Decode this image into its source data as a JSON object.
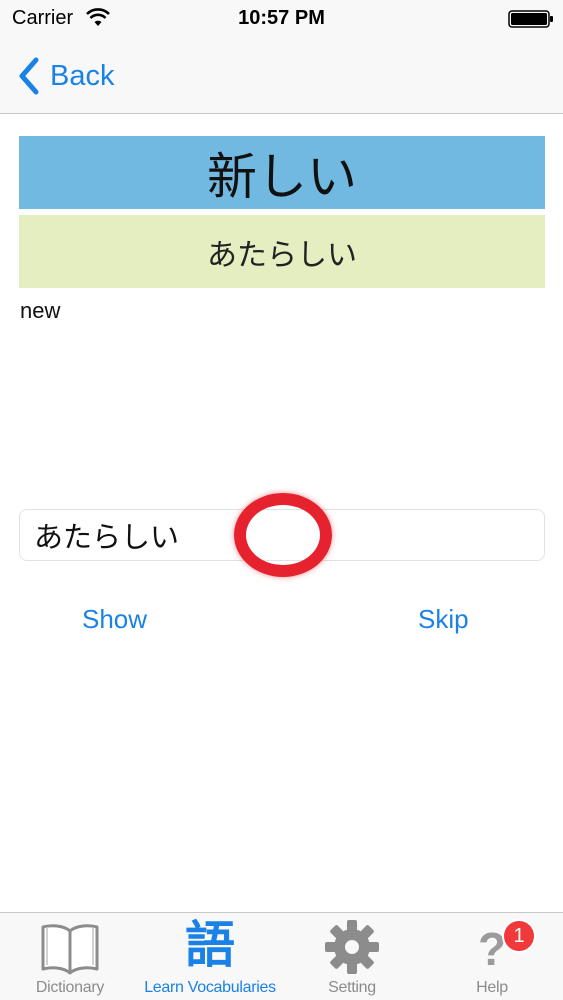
{
  "status_bar": {
    "carrier": "Carrier",
    "time": "10:57 PM",
    "icons": [
      "wifi-icon",
      "battery-icon"
    ]
  },
  "nav": {
    "back_label": "Back",
    "back_icon": "chevron-left-icon"
  },
  "card": {
    "kanji": "新しい",
    "reading": "あたらしい",
    "meaning": "new"
  },
  "answer": {
    "value": "あたらしい"
  },
  "actions": {
    "show_label": "Show",
    "skip_label": "Skip"
  },
  "tab_bar": {
    "tabs": [
      {
        "label": "Dictionary",
        "icon": "book-icon",
        "active": false
      },
      {
        "label": "Learn Vocabularies",
        "icon": "kanji-go-icon",
        "glyph": "語",
        "active": true
      },
      {
        "label": "Setting",
        "icon": "gear-icon",
        "active": false
      },
      {
        "label": "Help",
        "icon": "question-icon",
        "glyph": "?",
        "active": false,
        "badge": "1"
      }
    ]
  },
  "colors": {
    "accent": "#1a82e6",
    "kanji_card": "#72b9e1",
    "reading_card": "#e4eec1",
    "touch_indicator": "#e5222e",
    "badge": "#f03a3a"
  }
}
